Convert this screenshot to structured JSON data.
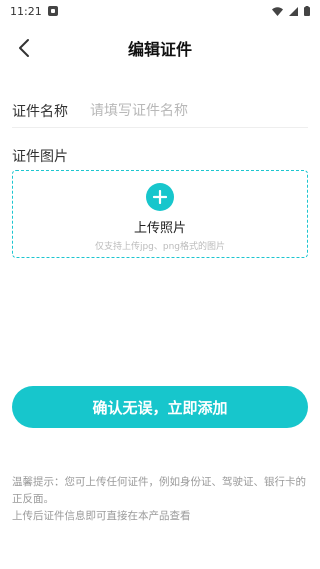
{
  "status_bar": {
    "time": "11:21",
    "icons": [
      "notification-icon",
      "wifi-icon",
      "signal-icon",
      "battery-icon"
    ]
  },
  "header": {
    "back_icon": "chevron-left-icon",
    "title": "编辑证件"
  },
  "form": {
    "name_label": "证件名称",
    "name_placeholder": "请填写证件名称",
    "name_value": ""
  },
  "upload": {
    "section_label": "证件图片",
    "plus_icon": "plus-circle-icon",
    "title": "上传照片",
    "hint": "仅支持上传jpg、png格式的图片"
  },
  "confirm_button": {
    "label": "确认无误，立即添加"
  },
  "tips": {
    "line1": "温馨提示：您可上传任何证件，例如身份证、驾驶证、银行卡的正反面。",
    "line2": "上传后证件信息即可直接在本产品查看"
  },
  "colors": {
    "accent": "#17c6cc",
    "dashed_border": "#1cc6d0",
    "placeholder": "#b8b8b8",
    "tips_text": "#9a9a9a"
  }
}
